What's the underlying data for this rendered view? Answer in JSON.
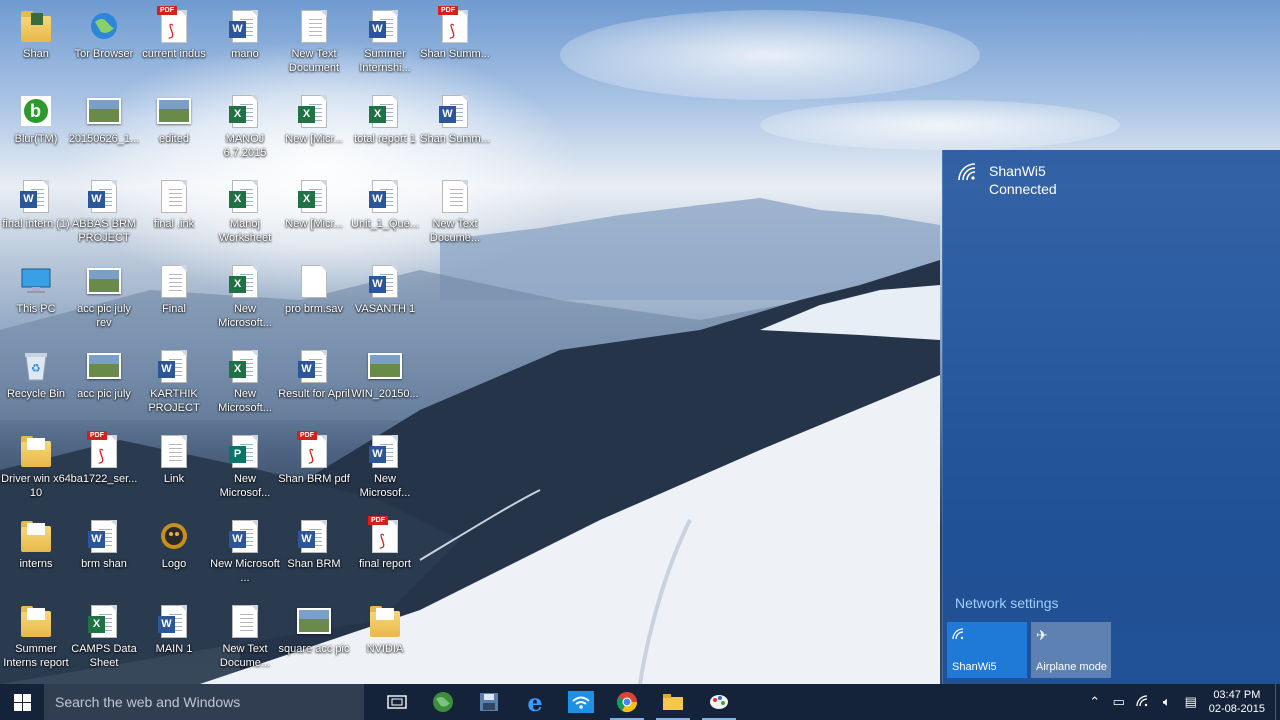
{
  "desktop": {
    "icons": [
      {
        "label": "Shan",
        "type": "user-folder"
      },
      {
        "label": "Tor Browser",
        "type": "globe"
      },
      {
        "label": "current indus",
        "type": "pdf"
      },
      {
        "label": "mano",
        "type": "word"
      },
      {
        "label": "New Text Document",
        "type": "text"
      },
      {
        "label": "Summer Internshi...",
        "type": "word"
      },
      {
        "label": "Shan Summ...",
        "type": "pdf"
      },
      {
        "label": "Blur(TM)",
        "type": "app"
      },
      {
        "label": "20150626_1...",
        "type": "photo"
      },
      {
        "label": "edited",
        "type": "photo"
      },
      {
        "label": "MANOJ 6.7.2015",
        "type": "excel"
      },
      {
        "label": "New [Micr...",
        "type": "excel"
      },
      {
        "label": "total report 1",
        "type": "excel"
      },
      {
        "label": "Shan Summ...",
        "type": "word"
      },
      {
        "label": "final intern (1)",
        "type": "word"
      },
      {
        "label": "ABBAS BRM PROJECT",
        "type": "word"
      },
      {
        "label": "final .ink",
        "type": "text"
      },
      {
        "label": "Manoj Worksheet",
        "type": "excel"
      },
      {
        "label": "New [Micr...",
        "type": "excel"
      },
      {
        "label": "Unit_1_Que...",
        "type": "word"
      },
      {
        "label": "New Text Docume...",
        "type": "text"
      },
      {
        "label": "This PC",
        "type": "pc"
      },
      {
        "label": "acc pic july rev",
        "type": "photo"
      },
      {
        "label": "Final",
        "type": "text"
      },
      {
        "label": "New Microsoft...",
        "type": "excel"
      },
      {
        "label": "pro brm.sav",
        "type": "blank"
      },
      {
        "label": "VASANTH 1",
        "type": "word"
      },
      {
        "label": "Recycle Bin",
        "type": "bin"
      },
      {
        "label": "acc pic july",
        "type": "photo"
      },
      {
        "label": "KARTHIK PROJECT",
        "type": "word"
      },
      {
        "label": "New Microsoft...",
        "type": "excel"
      },
      {
        "label": "Result for April",
        "type": "word"
      },
      {
        "label": "WIN_20150...",
        "type": "photo"
      },
      {
        "label": "Driver win x64 10",
        "type": "folder"
      },
      {
        "label": "ba1722_ser...",
        "type": "pdf"
      },
      {
        "label": "Link",
        "type": "text"
      },
      {
        "label": "New Microsof...",
        "type": "publisher"
      },
      {
        "label": "Shan BRM pdf",
        "type": "pdf"
      },
      {
        "label": "New Microsof...",
        "type": "word"
      },
      {
        "label": "interns",
        "type": "folder"
      },
      {
        "label": "brm shan",
        "type": "word"
      },
      {
        "label": "Logo",
        "type": "logo"
      },
      {
        "label": "New Microsoft ...",
        "type": "word"
      },
      {
        "label": "Shan BRM",
        "type": "word"
      },
      {
        "label": "final report",
        "type": "pdf"
      },
      {
        "label": "Summer Interns report",
        "type": "folder"
      },
      {
        "label": "CAMPS Data Sheet",
        "type": "excel"
      },
      {
        "label": "MAIN 1",
        "type": "word"
      },
      {
        "label": "New Text Docume...",
        "type": "text"
      },
      {
        "label": "square acc pic",
        "type": "photo"
      },
      {
        "label": "NVIDIA",
        "type": "folder"
      }
    ]
  },
  "network_flyout": {
    "network_name": "ShanWi5",
    "network_status": "Connected",
    "settings_link": "Network settings",
    "tiles": [
      {
        "label": "ShanWi5",
        "icon": "wifi-icon"
      },
      {
        "label": "Airplane mode",
        "icon": "airplane-icon"
      }
    ]
  },
  "taskbar": {
    "search_placeholder": "Search the web and Windows",
    "apps": [
      "task-view-icon",
      "globe-icon",
      "save-icon",
      "edge-icon",
      "wifi-app-icon",
      "chrome-icon",
      "file-explorer-icon",
      "paint-icon"
    ],
    "time": "03:47 PM",
    "date": "02-08-2015"
  },
  "colors": {
    "flyout_bg": "#1f529c",
    "tile_active": "#1e7ad6",
    "link": "#9fd0ff",
    "taskbar": "#15233a"
  }
}
